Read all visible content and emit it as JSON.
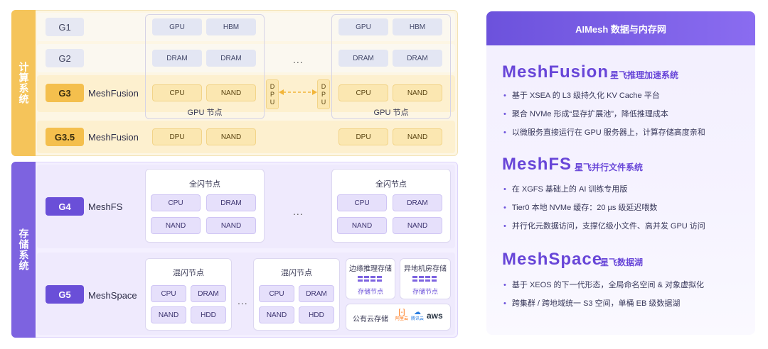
{
  "left": {
    "compute_label": "计算系统",
    "storage_label": "存储系统",
    "rows": {
      "g1": {
        "badge": "G1"
      },
      "g2": {
        "badge": "G2"
      },
      "g3": {
        "badge": "G3",
        "name": "MeshFusion"
      },
      "g35": {
        "badge": "G3.5",
        "name": "MeshFusion"
      },
      "g4": {
        "badge": "G4",
        "name": "MeshFS"
      },
      "g5": {
        "badge": "G5",
        "name": "MeshSpace"
      }
    },
    "gpu_node": {
      "title": "GPU 节点",
      "gpu": "GPU",
      "hbm": "HBM",
      "dram": "DRAM",
      "cpu": "CPU",
      "nand": "NAND"
    },
    "dpu_chip": "DPU",
    "dpu_vertical": [
      "D",
      "P",
      "U"
    ],
    "ellipsis": "...",
    "flash_node": {
      "title": "全闪节点",
      "cpu": "CPU",
      "dram": "DRAM",
      "nand": "NAND"
    },
    "hybrid_node": {
      "title": "混闪节点",
      "cpu": "CPU",
      "dram": "DRAM",
      "nand": "NAND",
      "hdd": "HDD"
    },
    "edge_storage": {
      "title": "边缘推理存储",
      "node": "存储节点"
    },
    "offsite_storage": {
      "title": "异地机房存储",
      "node": "存储节点"
    },
    "public_cloud": {
      "title": "公有云存储",
      "logos": [
        "阿里云",
        "腾讯云",
        "aws"
      ]
    }
  },
  "panel": {
    "header": "AIMesh 数据与内存网",
    "sections": [
      {
        "brand": "MeshFusion",
        "subtitle": "星飞推理加速系统",
        "bullets": [
          "基于 XSEA 的 L3 级持久化 KV Cache 平台",
          "聚合 NVMe 形成“显存扩展池”，降低推理成本",
          "以微服务直接运行在 GPU 服务器上，计算存储高度亲和"
        ]
      },
      {
        "brand": "MeshFS",
        "subtitle": "星飞并行文件系统",
        "bullets": [
          "在 XGFS 基础上的 AI 训练专用版",
          "Tier0 本地 NVMe 缓存：20 µs 级延迟喂数",
          "并行化元数据访问，支撑亿级小文件、高并发 GPU 访问"
        ]
      },
      {
        "brand": "MeshSpace",
        "subtitle": "星飞数据湖",
        "bullets": [
          "基于 XEOS 的下一代形态，全局命名空间 & 对象虚拟化",
          "跨集群 / 跨地域统一 S3 空间，单桶 EB 级数据湖"
        ]
      }
    ]
  }
}
